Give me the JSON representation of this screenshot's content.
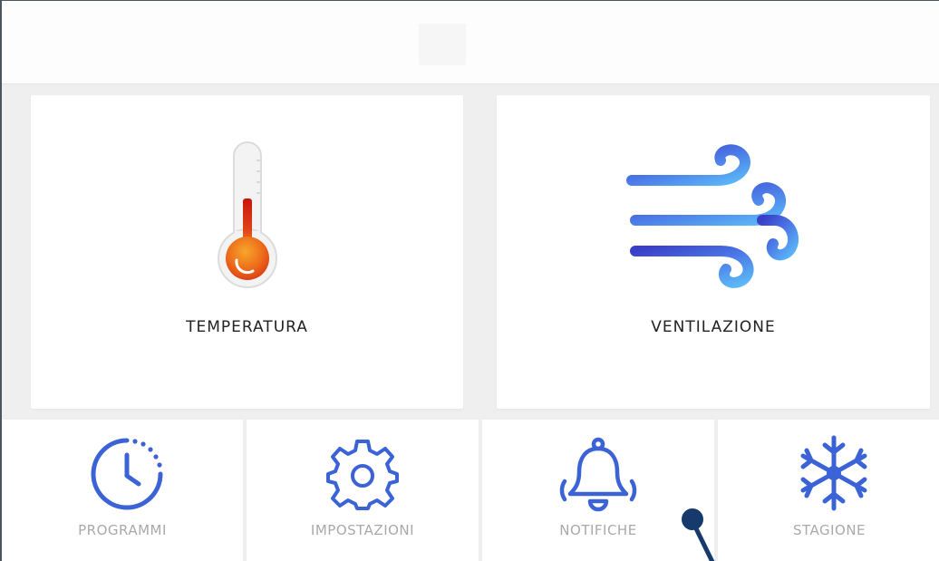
{
  "colors": {
    "accent": "#3b63d6",
    "tile_label": "#a9a9a9",
    "card_label": "#222222",
    "background": "#efefef",
    "thermo_red": "#d41c10",
    "thermo_orange": "#f07e1c",
    "wind_dark": "#3a41c9",
    "wind_light": "#58b0f6"
  },
  "cards": [
    {
      "label": "TEMPERATURA",
      "icon": "thermometer-icon"
    },
    {
      "label": "VENTILAZIONE",
      "icon": "wind-icon"
    }
  ],
  "tiles": [
    {
      "label": "PROGRAMMI",
      "icon": "clock-icon"
    },
    {
      "label": "IMPOSTAZIONI",
      "icon": "gear-icon"
    },
    {
      "label": "NOTIFICHE",
      "icon": "bell-icon"
    },
    {
      "label": "STAGIONE",
      "icon": "snowflake-icon"
    }
  ]
}
